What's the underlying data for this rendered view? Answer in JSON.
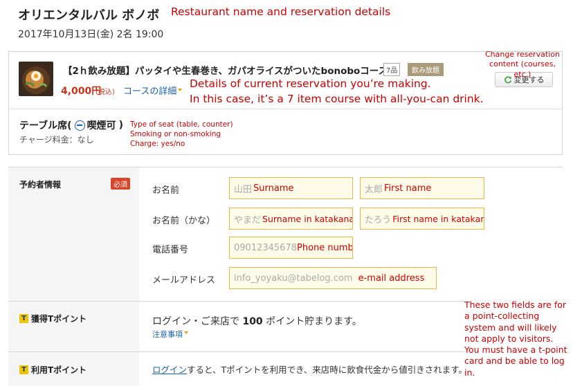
{
  "header": {
    "restaurant_name": "オリエンタルバル ボノボ",
    "reservation_date": "2017年10月13日(金) 2名 19:00"
  },
  "course": {
    "name": "【2ｈ飲み放題】パッタイや生春巻き、ガパオライスがついたbonoboコース★",
    "items_badge": "7品",
    "drink_badge": "飲み放題",
    "price": "4,000円",
    "price_tax": "(税込)",
    "detail_link": "コースの詳細",
    "change_button": "変更する"
  },
  "seat": {
    "type_prefix": "テーブル席(",
    "smoking": "喫煙可",
    "type_suffix": ")",
    "charge": "チャージ料金：なし"
  },
  "form": {
    "section_label": "予約者情報",
    "required_badge": "必須",
    "name_label": "お名前",
    "surname_placeholder": "山田",
    "firstname_placeholder": "太郎",
    "kana_label": "お名前（かな）",
    "surname_kana_placeholder": "やまだ",
    "firstname_kana_placeholder": "たろう",
    "phone_label": "電話番号",
    "phone_placeholder": "09012345678",
    "email_label": "メールアドレス",
    "email_placeholder": "info_yoyaku@tabelog.com"
  },
  "points": {
    "earn_label": "獲得Tポイント",
    "earn_text_prefix": "ログイン・ご来店で",
    "earn_amount": "100",
    "earn_text_suffix": "ポイント貯まります。",
    "notes_link": "注意事項",
    "use_label": "利用Tポイント",
    "login_link": "ログイン",
    "use_text": "すると、Tポイントを利用でき、来店時に飲食代金から値引きされます。"
  },
  "annotations": {
    "restaurant": "Restaurant name and reservation details",
    "change": "Change reservation content (courses, etc.)",
    "details_line1": "Details of current reservation you’re making.",
    "details_line2": "In this case, it’s a 7 item course with all-you-can drink.",
    "seat_line1": "Type of seat (table, counter)",
    "seat_line2": "Smoking or non-smoking",
    "seat_line3": "Charge: yes/no",
    "surname": "Surname",
    "firstname": "First name",
    "surname_kana": "Surname in katakana",
    "firstname_kana": "First name in katakana",
    "phone": "Phone number",
    "email": "e-mail address",
    "tpoint": "These two fields are for a point-collecting system and will likely not apply to visitors. You must have a t-point card and be able to log in."
  },
  "colors": {
    "accent_red": "#c4351a",
    "link_blue": "#1a5fa8",
    "annotation_red": "#cc0000",
    "field_border": "#e8b547",
    "required_badge": "#d9442a",
    "drink_badge": "#a99b79"
  }
}
